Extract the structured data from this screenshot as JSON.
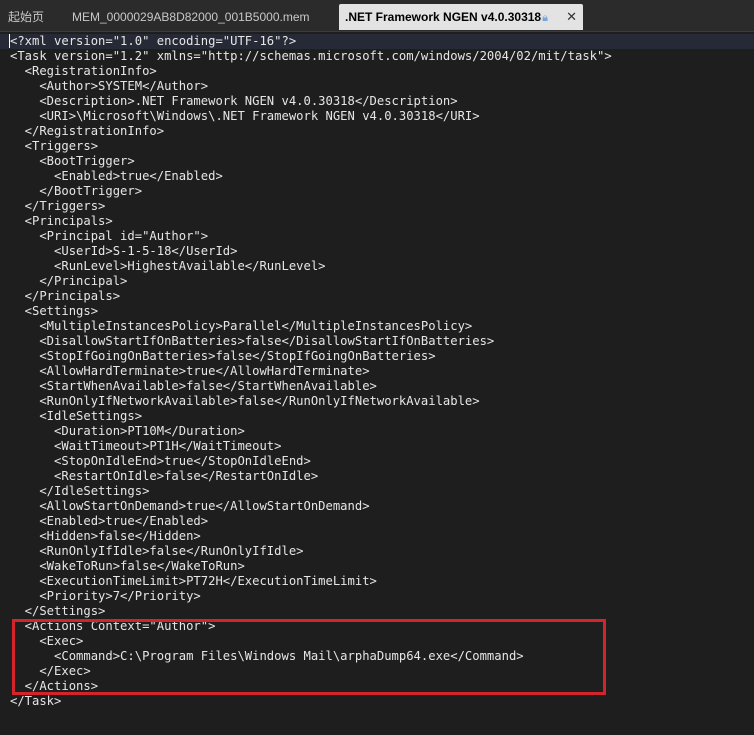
{
  "tabs": [
    {
      "label": "起始页",
      "active": false
    },
    {
      "label": "MEM_0000029AB8D82000_001B5000.mem",
      "active": false
    },
    {
      "label": ".NET Framework NGEN v4.0.30318",
      "active": true,
      "lock_icon": "lock-icon",
      "close_icon": "close-icon"
    }
  ],
  "colors": {
    "background": "#1e1e1e",
    "tab_active_bg": "#e3e3e3",
    "highlight_border": "#d3242b",
    "text": "#e6e6e6"
  },
  "lines": [
    "<?xml version=\"1.0\" encoding=\"UTF-16\"?>",
    "<Task version=\"1.2\" xmlns=\"http://schemas.microsoft.com/windows/2004/02/mit/task\">",
    "  <RegistrationInfo>",
    "    <Author>SYSTEM</Author>",
    "    <Description>.NET Framework NGEN v4.0.30318</Description>",
    "    <URI>\\Microsoft\\Windows\\.NET Framework NGEN v4.0.30318</URI>",
    "  </RegistrationInfo>",
    "  <Triggers>",
    "    <BootTrigger>",
    "      <Enabled>true</Enabled>",
    "    </BootTrigger>",
    "  </Triggers>",
    "  <Principals>",
    "    <Principal id=\"Author\">",
    "      <UserId>S-1-5-18</UserId>",
    "      <RunLevel>HighestAvailable</RunLevel>",
    "    </Principal>",
    "  </Principals>",
    "  <Settings>",
    "    <MultipleInstancesPolicy>Parallel</MultipleInstancesPolicy>",
    "    <DisallowStartIfOnBatteries>false</DisallowStartIfOnBatteries>",
    "    <StopIfGoingOnBatteries>false</StopIfGoingOnBatteries>",
    "    <AllowHardTerminate>true</AllowHardTerminate>",
    "    <StartWhenAvailable>false</StartWhenAvailable>",
    "    <RunOnlyIfNetworkAvailable>false</RunOnlyIfNetworkAvailable>",
    "    <IdleSettings>",
    "      <Duration>PT10M</Duration>",
    "      <WaitTimeout>PT1H</WaitTimeout>",
    "      <StopOnIdleEnd>true</StopOnIdleEnd>",
    "      <RestartOnIdle>false</RestartOnIdle>",
    "    </IdleSettings>",
    "    <AllowStartOnDemand>true</AllowStartOnDemand>",
    "    <Enabled>true</Enabled>",
    "    <Hidden>false</Hidden>",
    "    <RunOnlyIfIdle>false</RunOnlyIfIdle>",
    "    <WakeToRun>false</WakeToRun>",
    "    <ExecutionTimeLimit>PT72H</ExecutionTimeLimit>",
    "    <Priority>7</Priority>",
    "  </Settings>",
    "  <Actions Context=\"Author\">",
    "    <Exec>",
    "      <Command>C:\\Program Files\\Windows Mail\\arphaDump64.exe</Command>",
    "    </Exec>",
    "  </Actions>",
    "</Task>"
  ]
}
